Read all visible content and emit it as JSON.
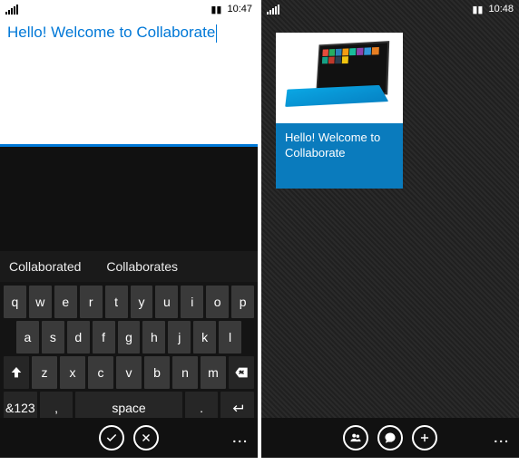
{
  "left": {
    "status": {
      "time": "10:47"
    },
    "editor": {
      "text": "Hello! Welcome to Collaborate"
    },
    "suggestions": [
      "Collaborated",
      "Collaborates"
    ],
    "keyboard": {
      "row1": [
        "q",
        "w",
        "e",
        "r",
        "t",
        "y",
        "u",
        "i",
        "o",
        "p"
      ],
      "row2": [
        "a",
        "s",
        "d",
        "f",
        "g",
        "h",
        "j",
        "k",
        "l"
      ],
      "row3": [
        "z",
        "x",
        "c",
        "v",
        "b",
        "n",
        "m"
      ],
      "row4": {
        "sym": "&123",
        "comma": ",",
        "space": "space",
        "period": "."
      }
    },
    "appbar": {
      "accept": "accept",
      "cancel": "cancel",
      "more": "..."
    }
  },
  "right": {
    "status": {
      "time": "10:48"
    },
    "tile": {
      "text": "Hello! Welcome to Collaborate"
    },
    "appbar": {
      "people": "people",
      "chat": "chat",
      "add": "add",
      "more": "..."
    }
  }
}
